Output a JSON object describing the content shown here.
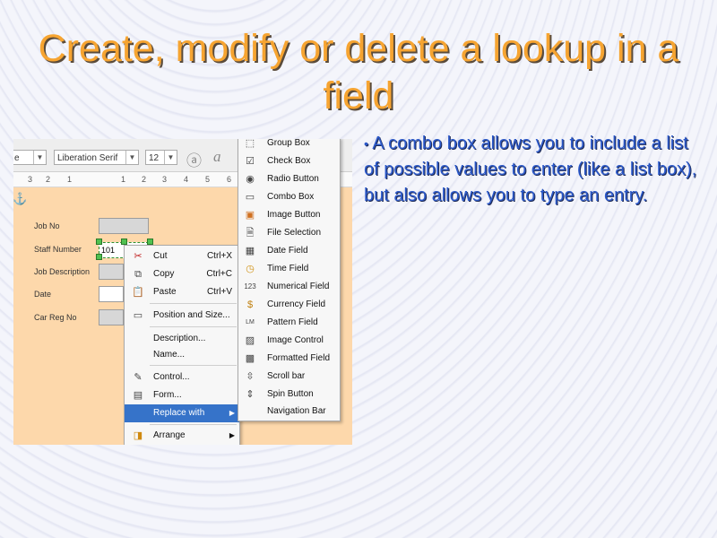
{
  "slide": {
    "title": "Create, modify or delete a lookup in a field",
    "bullet": "A combo box allows you to include a list of possible values to enter (like a list box), but also allows you to type an entry."
  },
  "toolbar": {
    "style_box": "e",
    "font_name": "Liberation Serif",
    "font_size": "12"
  },
  "ruler": [
    "3",
    "2",
    "1",
    "1",
    "2",
    "3",
    "4",
    "5",
    "6"
  ],
  "form": {
    "labels": [
      "Job No",
      "Staff Number",
      "Job Description",
      "Date",
      "Car Reg No"
    ],
    "staff_value": "101"
  },
  "context_menu": [
    {
      "icon": "scissors-icon",
      "glyph": "✂",
      "label": "Cut",
      "shortcut": "Ctrl+X"
    },
    {
      "icon": "copy-icon",
      "glyph": "⧉",
      "label": "Copy",
      "shortcut": "Ctrl+C"
    },
    {
      "icon": "paste-icon",
      "glyph": "📋",
      "label": "Paste",
      "shortcut": "Ctrl+V"
    },
    {
      "icon": "position-size-icon",
      "glyph": "▭",
      "label": "Position and Size..."
    },
    {
      "icon": "",
      "glyph": "",
      "label": "Description..."
    },
    {
      "icon": "",
      "glyph": "",
      "label": "Name..."
    },
    {
      "icon": "control-icon",
      "glyph": "✎",
      "label": "Control..."
    },
    {
      "icon": "form-icon",
      "glyph": "▤",
      "label": "Form..."
    },
    {
      "icon": "",
      "glyph": "",
      "label": "Replace with",
      "arrow": "▶"
    },
    {
      "icon": "arrange-icon",
      "glyph": "◨",
      "label": "Arrange",
      "arrow": "▶"
    }
  ],
  "submenu": [
    {
      "icon": "group-box-icon",
      "glyph": "⬚",
      "label": "Group Box"
    },
    {
      "icon": "check-box-icon",
      "glyph": "☑",
      "label": "Check Box"
    },
    {
      "icon": "radio-button-icon",
      "glyph": "◉",
      "label": "Radio Button"
    },
    {
      "icon": "combo-box-icon",
      "glyph": "▭",
      "label": "Combo Box"
    },
    {
      "icon": "image-button-icon",
      "glyph": "▣",
      "label": "Image Button"
    },
    {
      "icon": "file-selection-icon",
      "glyph": "🗎",
      "label": "File Selection"
    },
    {
      "icon": "date-field-icon",
      "glyph": "▦",
      "label": "Date Field"
    },
    {
      "icon": "time-field-icon",
      "glyph": "◷",
      "label": "Time Field"
    },
    {
      "icon": "numerical-field-icon",
      "glyph": "123",
      "label": "Numerical Field"
    },
    {
      "icon": "currency-field-icon",
      "glyph": "$",
      "label": "Currency Field"
    },
    {
      "icon": "pattern-field-icon",
      "glyph": "LM",
      "label": "Pattern Field"
    },
    {
      "icon": "image-control-icon",
      "glyph": "▨",
      "label": "Image Control"
    },
    {
      "icon": "formatted-field-icon",
      "glyph": "▩",
      "label": "Formatted Field"
    },
    {
      "icon": "scroll-bar-icon",
      "glyph": "⇳",
      "label": "Scroll bar"
    },
    {
      "icon": "spin-button-icon",
      "glyph": "⇕",
      "label": "Spin Button"
    },
    {
      "icon": "",
      "glyph": "",
      "label": "Navigation Bar"
    }
  ]
}
